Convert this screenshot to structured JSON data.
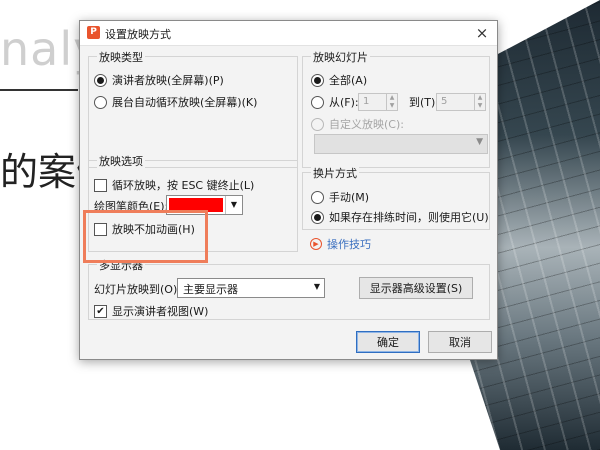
{
  "slide": {
    "bg_word": "naly",
    "heading": "的案例"
  },
  "dialog": {
    "app_icon": "P",
    "title": "设置放映方式",
    "close_label": "×"
  },
  "show_type": {
    "legend": "放映类型",
    "options": [
      {
        "label": "演讲者放映(全屏幕)(P)",
        "checked": true
      },
      {
        "label": "展台自动循环放映(全屏幕)(K)",
        "checked": false
      }
    ]
  },
  "slides": {
    "legend": "放映幻灯片",
    "all_label": "全部(A)",
    "from_label": "从(F):",
    "from_value": "1",
    "to_label": "到(T):",
    "to_value": "5",
    "custom_label": "自定义放映(C):"
  },
  "show_options": {
    "legend": "放映选项",
    "loop_label": "循环放映，按 ESC 键终止(L)",
    "pen_color_label": "绘图笔颜色(E):",
    "pen_color": "#ff0000",
    "no_animation_label": "放映不加动画(H)"
  },
  "advance": {
    "legend": "换片方式",
    "manual_label": "手动(M)",
    "timings_label": "如果存在排练时间，则使用它(U)"
  },
  "tips_link": "操作技巧",
  "monitors": {
    "legend": "多显示器",
    "show_on_label": "幻灯片放映到(O):",
    "show_on_value": "主要显示器",
    "advanced_button": "显示器高级设置(S)",
    "presenter_view_label": "显示演讲者视图(W)"
  },
  "buttons": {
    "ok": "确定",
    "cancel": "取消"
  },
  "colors": {
    "accent": "#e9542d",
    "highlight": "#ef7d5a",
    "link": "#3a6fbf"
  }
}
